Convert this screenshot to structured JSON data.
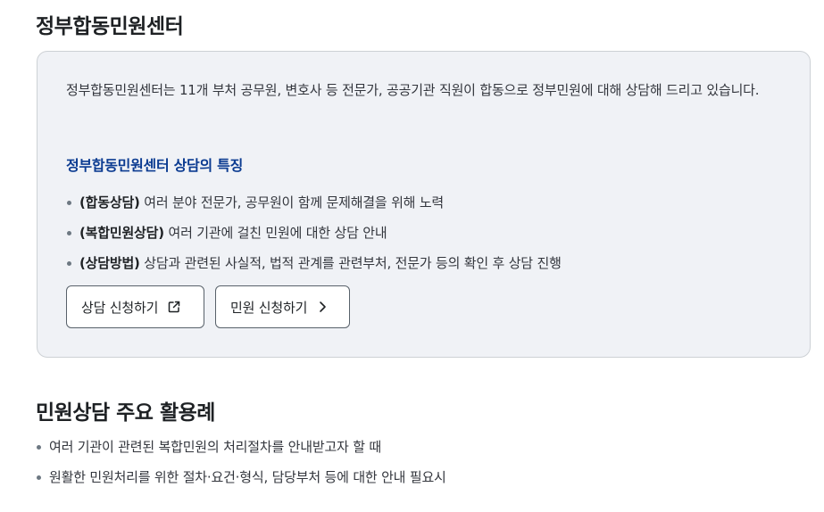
{
  "section1": {
    "title": "정부합동민원센터",
    "intro": "정부합동민원센터는 11개 부처 공무원, 변호사 등 전문가, 공공기관 직원이 합동으로 정부민원에 대해 상담해 드리고 있습니다.",
    "features_title": "정부합동민원센터 상담의 특징",
    "features": [
      {
        "label": "(합동상담)",
        "text": " 여러 분야 전문가, 공무원이 함께 문제해결을 위해 노력"
      },
      {
        "label": "(복합민원상담)",
        "text": " 여러 기관에 걸친 민원에 대한 상담 안내"
      },
      {
        "label": "(상담방법)",
        "text": " 상담과 관련된 사실적, 법적 관계를 관련부처, 전문가 등의 확인 후 상담 진행"
      }
    ],
    "buttons": {
      "consult": "상담 신청하기",
      "consult_icon": "external-link-icon",
      "petition": "민원 신청하기",
      "petition_icon": "chevron-right-icon"
    }
  },
  "section2": {
    "title": "민원상담 주요 활용례",
    "items": [
      "여러 기관이 관련된 복합민원의 처리절차를 안내받고자 할 때",
      "원활한 민원처리를 위한 절차·요건·형식, 담당부처 등에 대한 안내 필요시"
    ]
  },
  "colors": {
    "box_background": "#f0f2f6",
    "box_border": "#cdd1d5",
    "feature_title": "#0b3b91",
    "text": "#1e2124"
  }
}
